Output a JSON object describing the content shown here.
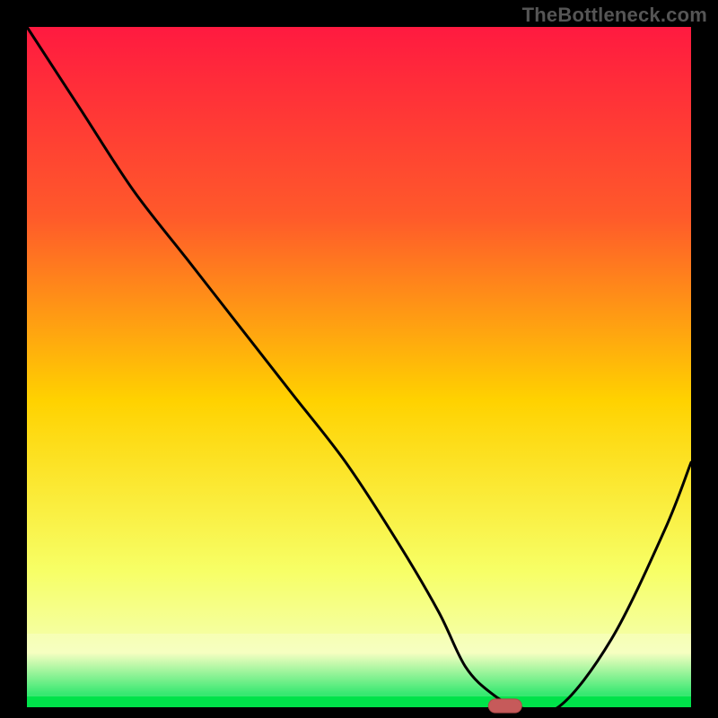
{
  "watermark": "TheBottleneck.com",
  "colors": {
    "frame": "#000000",
    "grad_top": "#ff1a40",
    "grad_mid_upper": "#ff7a1f",
    "grad_mid": "#ffd200",
    "grad_lower": "#f7ff66",
    "grad_green": "#00e24a",
    "curve": "#000000",
    "marker_fill": "#c65a5a",
    "marker_stroke": "#b44a4a"
  },
  "layout": {
    "margin_left": 30,
    "margin_right": 30,
    "margin_top": 30,
    "margin_bottom": 12,
    "green_bottom_h": 12,
    "pale_band_h": 70
  },
  "chart_data": {
    "type": "line",
    "title": "",
    "xlabel": "",
    "ylabel": "",
    "xlim": [
      0,
      100
    ],
    "ylim": [
      0,
      100
    ],
    "x": [
      0,
      8,
      16,
      24,
      32,
      40,
      48,
      56,
      62,
      66,
      70,
      74,
      80,
      88,
      96,
      100
    ],
    "values": [
      100,
      88,
      76,
      66,
      56,
      46,
      36,
      24,
      14,
      6,
      2,
      0,
      0,
      10,
      26,
      36
    ],
    "marker": {
      "x": 72,
      "y": 0,
      "w": 5,
      "h": 2
    },
    "gradient_stops": [
      {
        "pct": 0,
        "color": "#ff1a40"
      },
      {
        "pct": 28,
        "color": "#ff5a2a"
      },
      {
        "pct": 55,
        "color": "#ffd200"
      },
      {
        "pct": 80,
        "color": "#f7ff66"
      },
      {
        "pct": 92,
        "color": "#f4ffb0"
      },
      {
        "pct": 98,
        "color": "#00e24a"
      },
      {
        "pct": 100,
        "color": "#00e24a"
      }
    ]
  }
}
